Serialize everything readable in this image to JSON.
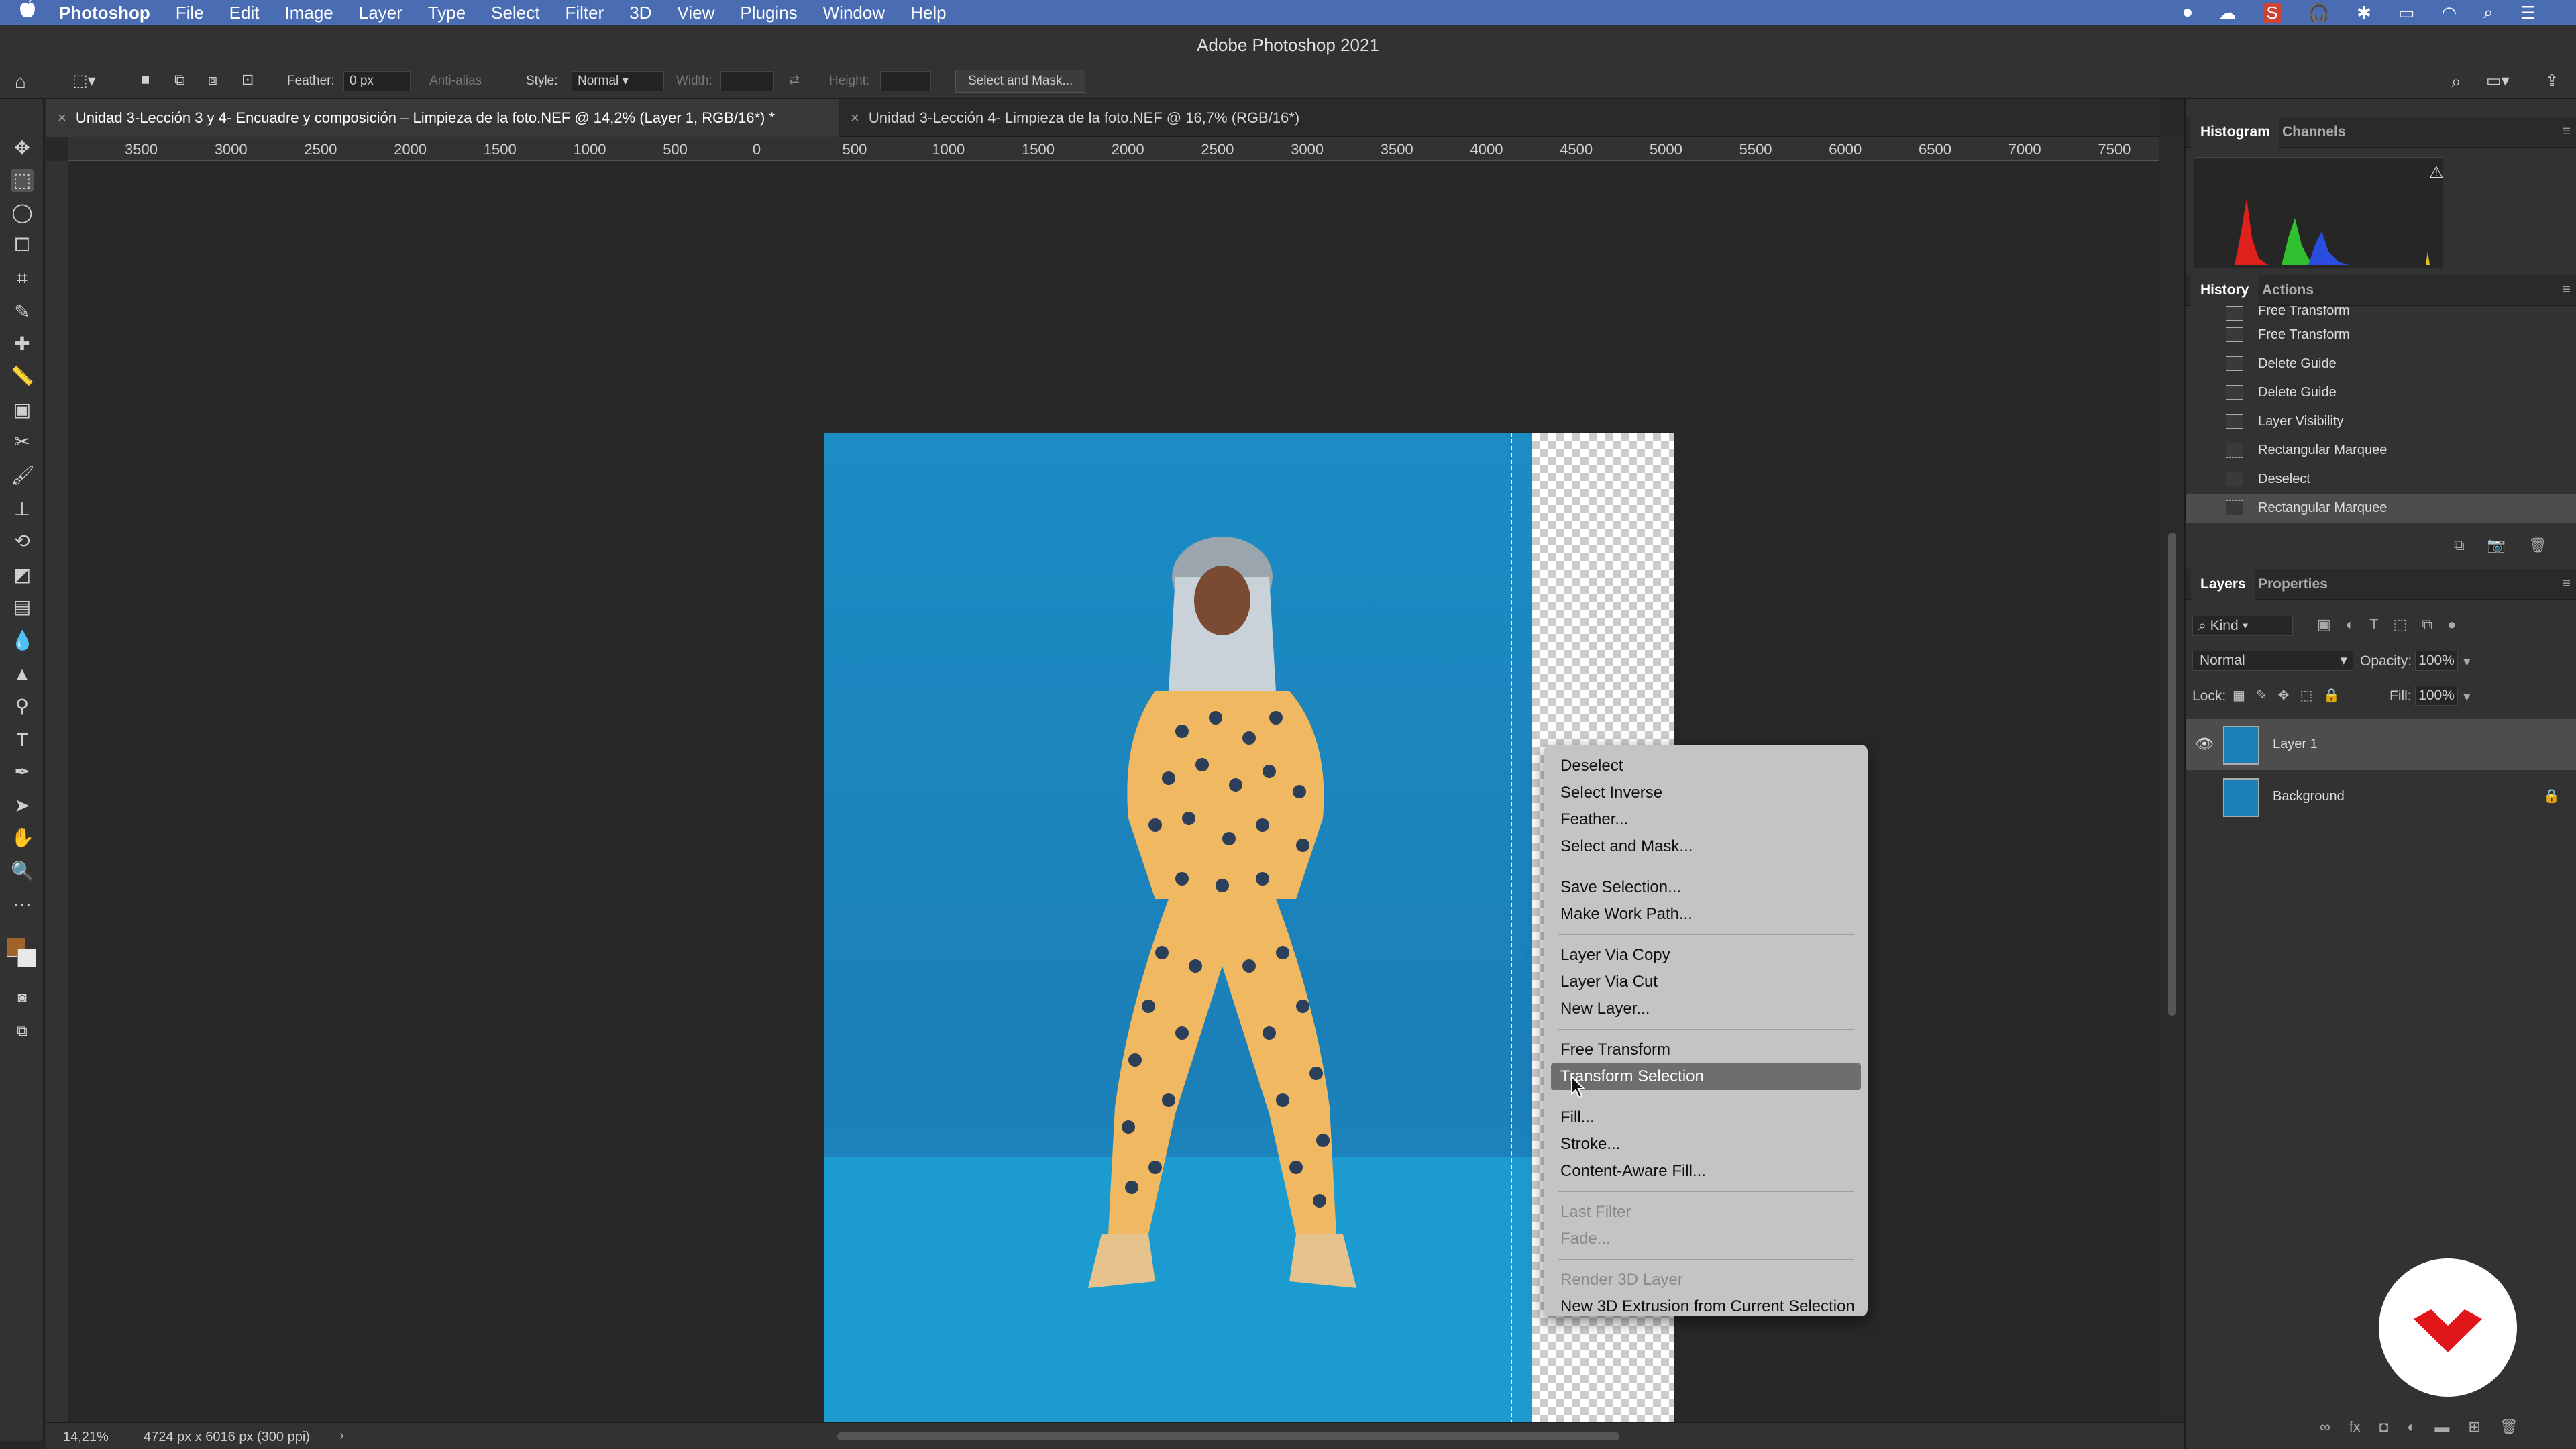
{
  "macbar": {
    "apple": "",
    "app": "Photoshop",
    "menus": [
      "File",
      "Edit",
      "Image",
      "Layer",
      "Type",
      "Select",
      "Filter",
      "3D",
      "View",
      "Plugins",
      "Window",
      "Help"
    ]
  },
  "titlebar": {
    "title": "Adobe Photoshop 2021"
  },
  "options": {
    "feather_label": "Feather:",
    "feather_value": "0 px",
    "antialias_label": "Anti-alias",
    "style_label": "Style:",
    "style_value": "Normal",
    "width_label": "Width:",
    "height_label": "Height:",
    "select_mask_button": "Select and Mask..."
  },
  "tabs": [
    {
      "label": "Unidad 3-Lección 3 y 4- Encuadre y composición – Limpieza de la foto.NEF @ 14,2% (Layer 1, RGB/16*) *"
    },
    {
      "label": "Unidad 3-Lección 4- Limpieza de la foto.NEF @ 16,7% (RGB/16*)"
    }
  ],
  "ruler": {
    "ticks": [
      "3500",
      "3000",
      "2500",
      "2000",
      "1500",
      "1000",
      "500",
      "0",
      "500",
      "1000",
      "1500",
      "2000",
      "2500",
      "3000",
      "3500",
      "4000",
      "4500",
      "5000",
      "5500",
      "6000",
      "6500",
      "7000",
      "7500"
    ]
  },
  "context_menu": {
    "groups": [
      [
        "Deselect",
        "Select Inverse",
        "Feather...",
        "Select and Mask..."
      ],
      [
        "Save Selection...",
        "Make Work Path..."
      ],
      [
        "Layer Via Copy",
        "Layer Via Cut",
        "New Layer..."
      ],
      [
        "Free Transform",
        "Transform Selection"
      ],
      [
        "Fill...",
        "Stroke...",
        "Content-Aware Fill..."
      ],
      [
        "Last Filter",
        "Fade..."
      ],
      [
        "Render 3D Layer",
        "New 3D Extrusion from Current Selection"
      ]
    ],
    "highlighted": "Transform Selection",
    "disabled": [
      "Last Filter",
      "Fade...",
      "Render 3D Layer"
    ]
  },
  "panels": {
    "histogram_tab": "Histogram",
    "channels_tab": "Channels",
    "history_tab": "History",
    "actions_tab": "Actions",
    "history_items": [
      "Free Transform",
      "Free Transform",
      "Delete Guide",
      "Delete Guide",
      "Layer Visibility",
      "Rectangular Marquee",
      "Deselect",
      "Rectangular Marquee"
    ],
    "layers_tab": "Layers",
    "properties_tab": "Properties",
    "kind_label": "Kind",
    "blend_mode": "Normal",
    "opacity_label": "Opacity:",
    "opacity_value": "100%",
    "lock_label": "Lock:",
    "fill_label": "Fill:",
    "fill_value": "100%",
    "layers": [
      {
        "name": "Layer 1",
        "visible": true,
        "selected": true
      },
      {
        "name": "Background",
        "visible": false,
        "locked": true
      }
    ]
  },
  "status": {
    "zoom": "14,21%",
    "doc_size": "4724 px x 6016 px (300 ppi)"
  },
  "colors": {
    "accent": "#4a6cb3",
    "brand_red": "#e0161b"
  }
}
